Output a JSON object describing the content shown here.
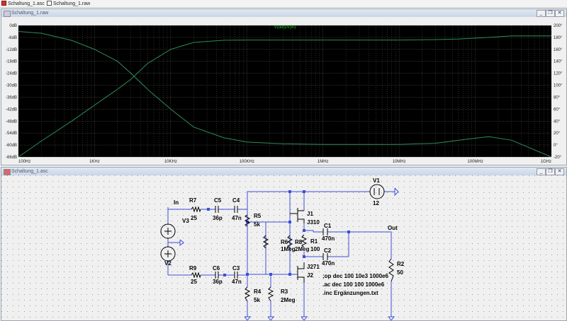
{
  "tabs": [
    {
      "label": "Schaltung_1.asc",
      "icon": "schematic-icon"
    },
    {
      "label": "Schaltung_1.raw",
      "icon": "waveform-icon"
    }
  ],
  "plot_window": {
    "title": "Schaltung_1.raw",
    "buttons": [
      "_",
      "❐",
      "✕"
    ]
  },
  "schematic_window": {
    "title": "Schaltung_1.asc",
    "buttons": [
      "_",
      "❐",
      "✕"
    ]
  },
  "colors": {
    "plot_bg": "#000000",
    "grid": "#5a5a5a",
    "trace": "#2e8b57",
    "trace_label": "#22cc22",
    "wire": "#3b4fd8",
    "component": "#000000",
    "schematic_bg": "#f0f0f0"
  },
  "chart_data": {
    "type": "line",
    "title": "V(out)/V(in)",
    "x": [
      "100Hz",
      "1KHz",
      "10KHz",
      "100KHz",
      "1MHz",
      "10MHz",
      "100MHz",
      "1GHz"
    ],
    "x_log_range": [
      100,
      1000000000
    ],
    "left_ticks": [
      "0dB",
      "-6dB",
      "-12dB",
      "-18dB",
      "-24dB",
      "-30dB",
      "-36dB",
      "-42dB",
      "-48dB",
      "-54dB",
      "-60dB",
      "-66dB"
    ],
    "right_ticks": [
      "200°",
      "180°",
      "160°",
      "140°",
      "120°",
      "100°",
      "80°",
      "60°",
      "40°",
      "20°",
      "0°",
      "-20°"
    ],
    "ylim_db": [
      -66,
      0
    ],
    "ylim_phase_deg": [
      -20,
      200
    ],
    "grid": true,
    "series": [
      {
        "name": "Magnitude",
        "axis": "left",
        "points": [
          [
            100,
            -66
          ],
          [
            200,
            -58
          ],
          [
            500,
            -48
          ],
          [
            1000,
            -40
          ],
          [
            2000,
            -32
          ],
          [
            3000,
            -27
          ],
          [
            5000,
            -19
          ],
          [
            10000,
            -12
          ],
          [
            20000,
            -8.5
          ],
          [
            50000,
            -7.4
          ],
          [
            100000,
            -7.3
          ],
          [
            1000000,
            -7.3
          ],
          [
            10000000,
            -7.3
          ],
          [
            30000000,
            -7.1
          ],
          [
            60000000,
            -6.8
          ],
          [
            150000000,
            -6.0
          ],
          [
            300000000,
            -5.2
          ],
          [
            1000000000,
            -5.2
          ]
        ]
      },
      {
        "name": "Phase",
        "axis": "right",
        "points": [
          [
            100,
            190
          ],
          [
            200,
            187
          ],
          [
            500,
            175
          ],
          [
            1000,
            160
          ],
          [
            2000,
            140
          ],
          [
            3000,
            120
          ],
          [
            5000,
            93
          ],
          [
            10000,
            60
          ],
          [
            20000,
            30
          ],
          [
            50000,
            12
          ],
          [
            100000,
            5
          ],
          [
            300000,
            2
          ],
          [
            1000000,
            1
          ],
          [
            10000000,
            1
          ],
          [
            30000000,
            3
          ],
          [
            70000000,
            9
          ],
          [
            150000000,
            14
          ],
          [
            300000000,
            8
          ],
          [
            1000000000,
            -20
          ]
        ]
      }
    ]
  },
  "schematic": {
    "labels": {
      "in": "In",
      "out": "Out",
      "r7": "R7",
      "r7v": "25",
      "c5": "C5",
      "c5v": "36p",
      "c4": "C4",
      "c4v": "47n",
      "r5": "R5",
      "r5v": "5k",
      "r6": "R6",
      "r6v": "1Meg",
      "r8": "R8",
      "r8v": "2Meg",
      "r1": "R1",
      "r1v": "100",
      "j1": "J1",
      "j1v": "J310",
      "c1": "C1",
      "c1v": "470n",
      "c2": "C2",
      "c2v": "470n",
      "j2": "J2",
      "j2v": "J271",
      "v1": "V1",
      "v1v": "12",
      "v2": "V2",
      "v3": "V3",
      "r9": "R9",
      "r9v": "25",
      "c6": "C6",
      "c6v": "36p",
      "c3": "C3",
      "c3v": "47n",
      "r4": "R4",
      "r4v": "5k",
      "r3": "R3",
      "r3v": "2Meg",
      "r2": "R2",
      "r2v": "50"
    },
    "directives": [
      ";op dec 100 10e3 1000e6",
      ".ac dec 100 100 1000e6",
      ".inc Ergänzungen.txt"
    ]
  }
}
